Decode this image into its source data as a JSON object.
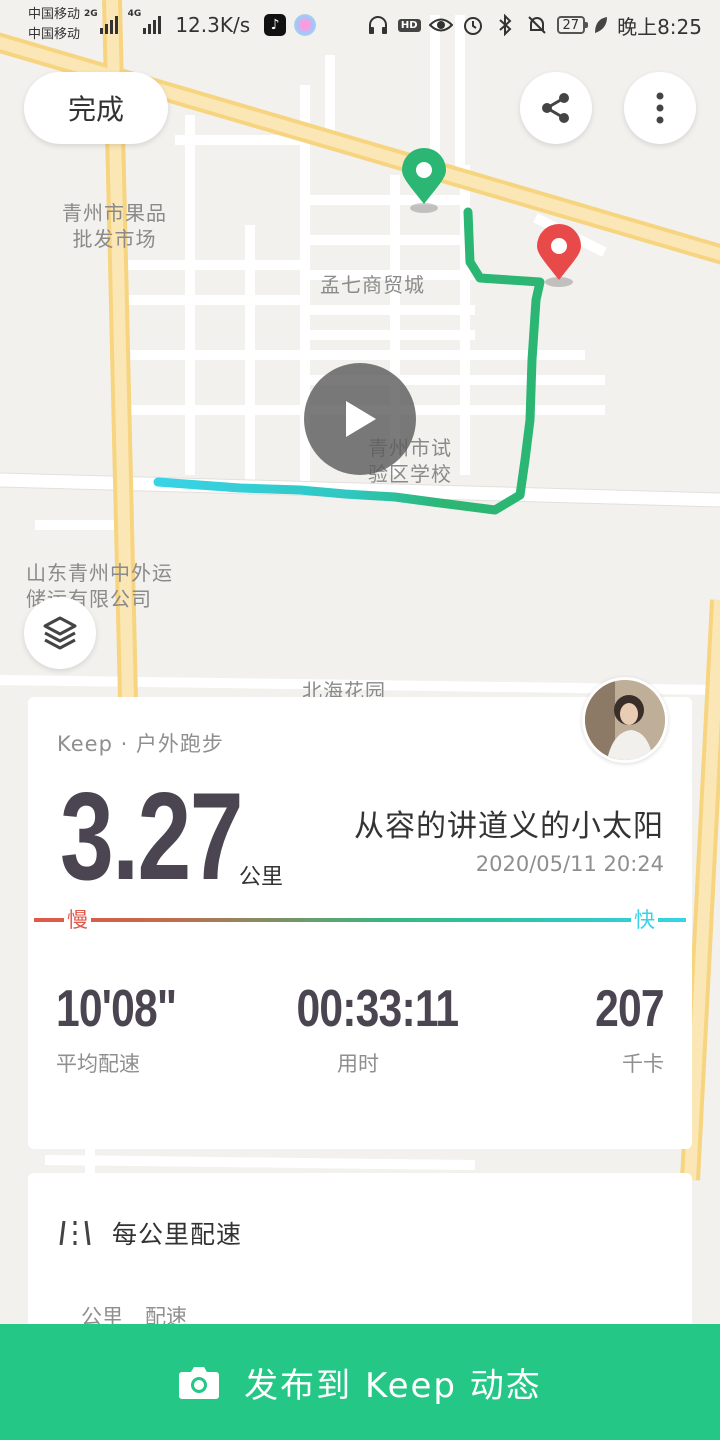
{
  "status_bar": {
    "carrier_1": "中国移动",
    "carrier_2": "中国移动",
    "net_1": "2G",
    "net_2": "4G",
    "speed": "12.3K/s",
    "hd": "HD",
    "battery": "27",
    "time": "晚上8:25"
  },
  "map": {
    "labels": {
      "market": "青州市果品\n批发市场",
      "trade_city": "孟七商贸城",
      "school": "青州市试\n验区学校",
      "company": "山东青州中外运\n储运有限公司",
      "garden": "北海花园"
    }
  },
  "toolbar": {
    "done_label": "完成"
  },
  "summary": {
    "sport_type": "Keep · 户外跑步",
    "distance": "3.27",
    "distance_unit": "公里",
    "user_name": "从容的讲道义的小太阳",
    "datetime": "2020/05/11 20:24",
    "pace_slow_label": "慢",
    "pace_fast_label": "快",
    "stats": {
      "avg_pace": {
        "value": "10'08\"",
        "label": "平均配速"
      },
      "duration": {
        "value": "00:33:11",
        "label": "用时"
      },
      "calories": {
        "value": "207",
        "label": "千卡"
      }
    }
  },
  "splits": {
    "title": "每公里配速",
    "col_km": "公里",
    "col_pace": "配速"
  },
  "publish": {
    "label": "发布到 Keep 动态"
  },
  "colors": {
    "accent_green": "#24c786",
    "start_pin": "#2bb673",
    "end_pin": "#e84a4a",
    "route_slow": "#2bb673",
    "route_fast": "#39d3e6"
  }
}
